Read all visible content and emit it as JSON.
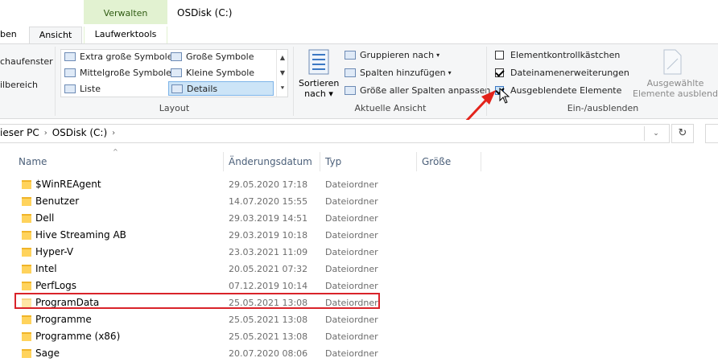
{
  "window": {
    "title": "OSDisk (C:)"
  },
  "contextual_tab_group": "Verwalten",
  "tabs": [
    {
      "label": "ben"
    },
    {
      "label": "Ansicht"
    },
    {
      "label": "Laufwerktools"
    }
  ],
  "panes_group": {
    "items": [
      "chaufenster",
      "ilbereich"
    ]
  },
  "layout_group": {
    "label": "Layout",
    "items": [
      {
        "label": "Extra große Symbole",
        "icon": "extra-large-icons-icon"
      },
      {
        "label": "Große Symbole",
        "icon": "large-icons-icon"
      },
      {
        "label": "Mittelgroße Symbole",
        "icon": "medium-icons-icon"
      },
      {
        "label": "Kleine Symbole",
        "icon": "small-icons-icon"
      },
      {
        "label": "Liste",
        "icon": "list-icon"
      },
      {
        "label": "Details",
        "icon": "details-icon",
        "selected": true
      }
    ]
  },
  "current_view_group": {
    "label": "Aktuelle Ansicht",
    "sort_label": "Sortieren nach",
    "sort_label_line1": "Sortieren",
    "sort_label_line2": "nach",
    "group_by": "Gruppieren nach",
    "add_columns": "Spalten hinzufügen",
    "size_columns": "Größe aller Spalten anpassen"
  },
  "show_hide_group": {
    "label": "Ein-/ausblenden",
    "checkboxes": [
      {
        "label": "Elementkontrollkästchen",
        "checked": false
      },
      {
        "label": "Dateinamenerweiterungen",
        "checked": true
      },
      {
        "label": "Ausgeblendete Elemente",
        "checked": true
      }
    ],
    "hide_selected_line1": "Ausgewählte",
    "hide_selected_line2": "Elemente ausblenden"
  },
  "breadcrumb": [
    "ieser PC",
    "OSDisk (C:)"
  ],
  "columns": [
    "Name",
    "Änderungsdatum",
    "Typ",
    "Größe"
  ],
  "rows": [
    {
      "name": "$WinREAgent",
      "date": "29.05.2020 17:18",
      "type": "Dateiordner"
    },
    {
      "name": "Benutzer",
      "date": "14.07.2020 15:55",
      "type": "Dateiordner"
    },
    {
      "name": "Dell",
      "date": "29.03.2019 14:51",
      "type": "Dateiordner"
    },
    {
      "name": "Hive Streaming AB",
      "date": "29.03.2019 10:18",
      "type": "Dateiordner"
    },
    {
      "name": "Hyper-V",
      "date": "23.03.2021 11:09",
      "type": "Dateiordner"
    },
    {
      "name": "Intel",
      "date": "20.05.2021 07:32",
      "type": "Dateiordner"
    },
    {
      "name": "PerfLogs",
      "date": "07.12.2019 10:14",
      "type": "Dateiordner"
    },
    {
      "name": "ProgramData",
      "date": "25.05.2021 13:08",
      "type": "Dateiordner",
      "highlighted": true
    },
    {
      "name": "Programme",
      "date": "25.05.2021 13:08",
      "type": "Dateiordner"
    },
    {
      "name": "Programme (x86)",
      "date": "25.05.2021 13:08",
      "type": "Dateiordner"
    },
    {
      "name": "Sage",
      "date": "20.07.2020 08:06",
      "type": "Dateiordner"
    }
  ],
  "colors": {
    "ribbon_bg": "#f5f6f7",
    "context_tab": "#e2f2d1",
    "highlight_box": "#d9232a",
    "annotation_arrow": "#e3231b"
  }
}
